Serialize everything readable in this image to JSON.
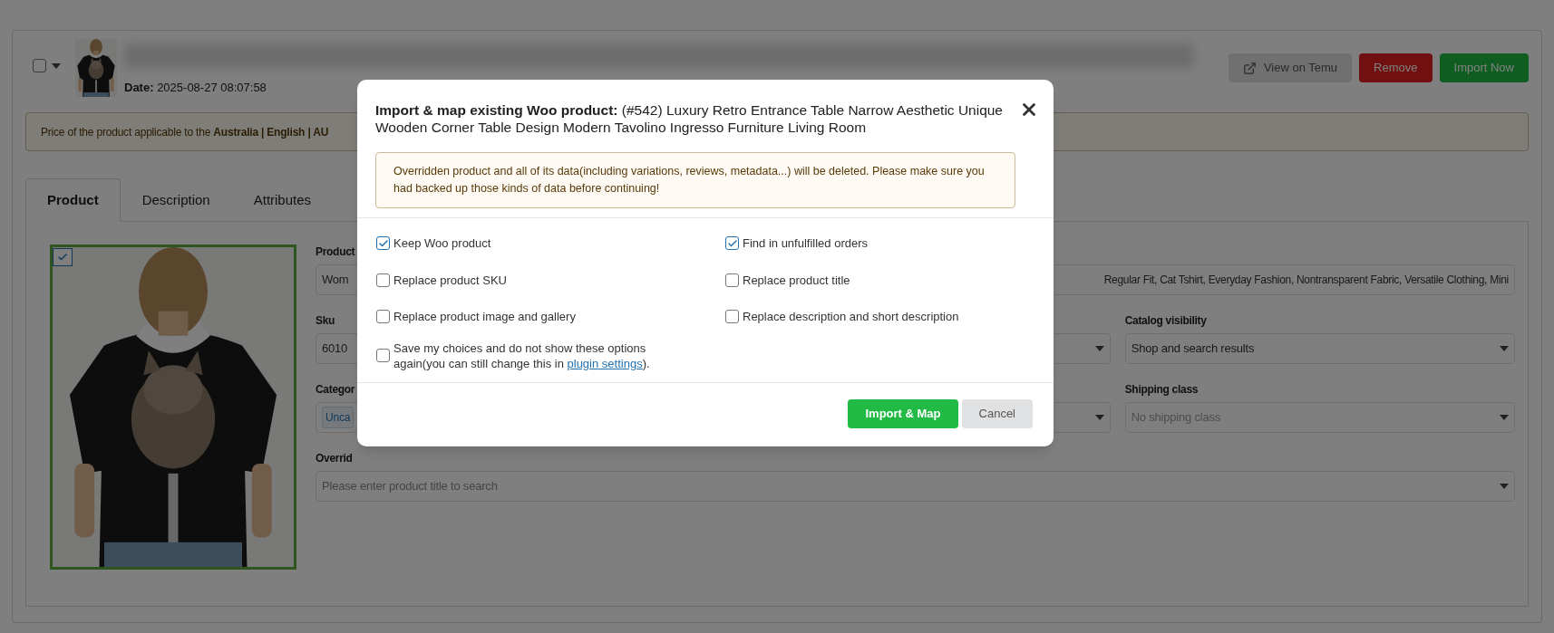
{
  "header": {
    "selected": false,
    "date_label": "Date:",
    "date": "2025-08-27 08:07:58",
    "buttons": [
      {
        "label": "View on Temu",
        "kind": "external"
      },
      {
        "label": "Remove",
        "kind": "danger"
      },
      {
        "label": "Import Now",
        "kind": "primary"
      }
    ]
  },
  "notice": "Price of the product applicable to the **Australia | English | AU**",
  "tabs": [
    {
      "label": "Product",
      "selected": true
    },
    {
      "label": "Description",
      "selected": false
    },
    {
      "label": "Attributes",
      "selected": false
    }
  ],
  "image": {
    "checked": true
  },
  "form": {
    "title_label": "Product",
    "title_value_start": "Wom",
    "title_value_end": "Regular Fit, Cat Tshirt, Everyday Fashion, Nontransparent Fabric, Versatile Clothing, Mini",
    "sku_label": "Sku",
    "sku_value": "6010",
    "catalog_label": "Catalog visibility",
    "catalog_value": "Shop and search results",
    "category_label": "Categor",
    "category_tag": "Unca",
    "shipping_label": "Shipping class",
    "shipping_placeholder": "No shipping class",
    "override_label": "Overrid",
    "override_placeholder": "Please enter product title to search"
  },
  "modal": {
    "title": "**Import & map existing Woo product:** (#542) Luxury Retro Entrance Table Narrow Aesthetic Unique Wooden Corner Table Design Modern Tavolino Ingresso Furniture Living Room",
    "warning": "Overridden product and all of its data(including variations, reviews, metadata...) will be deleted. Please make sure you had backed up those kinds of data before continuing!",
    "options": [
      {
        "label": "Keep Woo product",
        "checked": true
      },
      {
        "label": "Find in unfulfilled orders",
        "checked": true
      },
      {
        "label": "Replace product SKU",
        "checked": false
      },
      {
        "label": "Replace product title",
        "checked": false
      },
      {
        "label": "Replace product image and gallery",
        "checked": false
      },
      {
        "label": "Replace description and short description",
        "checked": false
      }
    ],
    "save": {
      "text": "Save my choices and do not show these options again(you can still change this in ",
      "link": "plugin settings",
      "after": ").",
      "checked": false
    },
    "buttons": [
      {
        "label": "Import & Map",
        "kind": "primary"
      },
      {
        "label": "Cancel",
        "kind": "secondary"
      }
    ]
  }
}
